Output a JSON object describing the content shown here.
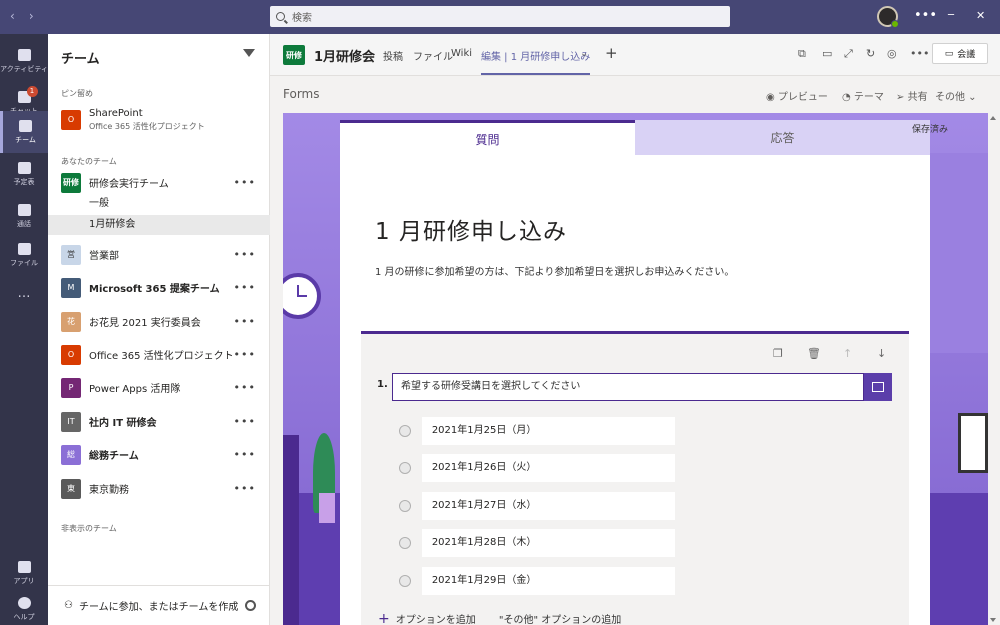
{
  "titlebar": {
    "search_placeholder": "検索",
    "back": "‹",
    "forward": "›",
    "minimize": "─",
    "maximize": "☐",
    "close": "✕"
  },
  "rail": [
    {
      "label": "アクティビティ",
      "id": "activity"
    },
    {
      "label": "チャット",
      "id": "chat",
      "badge": "1"
    },
    {
      "label": "チーム",
      "id": "teams"
    },
    {
      "label": "予定表",
      "id": "calendar"
    },
    {
      "label": "通話",
      "id": "calls"
    },
    {
      "label": "ファイル",
      "id": "files"
    },
    {
      "label": "…",
      "id": "more"
    },
    {
      "label": "アプリ",
      "id": "apps"
    },
    {
      "label": "ヘルプ",
      "id": "help"
    }
  ],
  "panel": {
    "title": "チーム",
    "pinned_heading": "ピン留め",
    "pinned": {
      "name": "SharePoint",
      "sub": "Office 365 活性化プロジェクト"
    },
    "your_teams_heading": "あなたのチーム",
    "teams": [
      {
        "name": "研修会実行チーム",
        "icon": "研修",
        "color": "#0d7a3b",
        "text_color": "#ffffff"
      },
      {
        "name": "営業部",
        "icon": "営",
        "color": "#c8d6e8"
      },
      {
        "name": "Microsoft 365 提案チーム",
        "icon": "M",
        "color": "#445b78",
        "bold": true
      },
      {
        "name": "お花見 2021 実行委員会",
        "icon": "花",
        "color": "#d8a070"
      },
      {
        "name": "Office 365 活性化プロジェクト",
        "icon": "O",
        "color": "#d83b01"
      },
      {
        "name": "Power Apps 活用隊",
        "icon": "P",
        "color": "#742774"
      },
      {
        "name": "社内 IT 研修会",
        "icon": "IT",
        "color": "#666",
        "bold": true
      },
      {
        "name": "総務チーム",
        "icon": "総",
        "color": "#8b6fd6",
        "bold": true
      },
      {
        "name": "東京勤務",
        "icon": "東",
        "color": "#5a5a5a"
      }
    ],
    "channels": [
      "一般",
      "1月研修会"
    ],
    "hidden_heading": "非表示のチーム",
    "footer": "チームに参加、またはチームを作成"
  },
  "header": {
    "icon": "研修",
    "title": "1月研修会",
    "tabs": [
      "投稿",
      "ファイル",
      "Wiki",
      "編集 | 1 月研修申し込み"
    ],
    "plus": "+",
    "more": "•••",
    "meet_label": "会議"
  },
  "forms": {
    "label": "Forms",
    "preview": "プレビュー",
    "theme": "テーマ",
    "share": "共有",
    "other": "その他",
    "saved": "保存済み",
    "tab_questions": "質問",
    "tab_responses": "応答",
    "title": "1 月研修申し込み",
    "description": "1 月の研修に参加希望の方は、下記より参加希望日を選択しお申込みください。",
    "question_number": "1.",
    "question_text": "希望する研修受講日を選択してください",
    "options": [
      "2021年1月25日（月）",
      "2021年1月26日（火）",
      "2021年1月27日（水）",
      "2021年1月28日（木）",
      "2021年1月29日（金）"
    ],
    "add_option": "オプションを追加",
    "add_other": "\"その他\" オプションの追加"
  }
}
